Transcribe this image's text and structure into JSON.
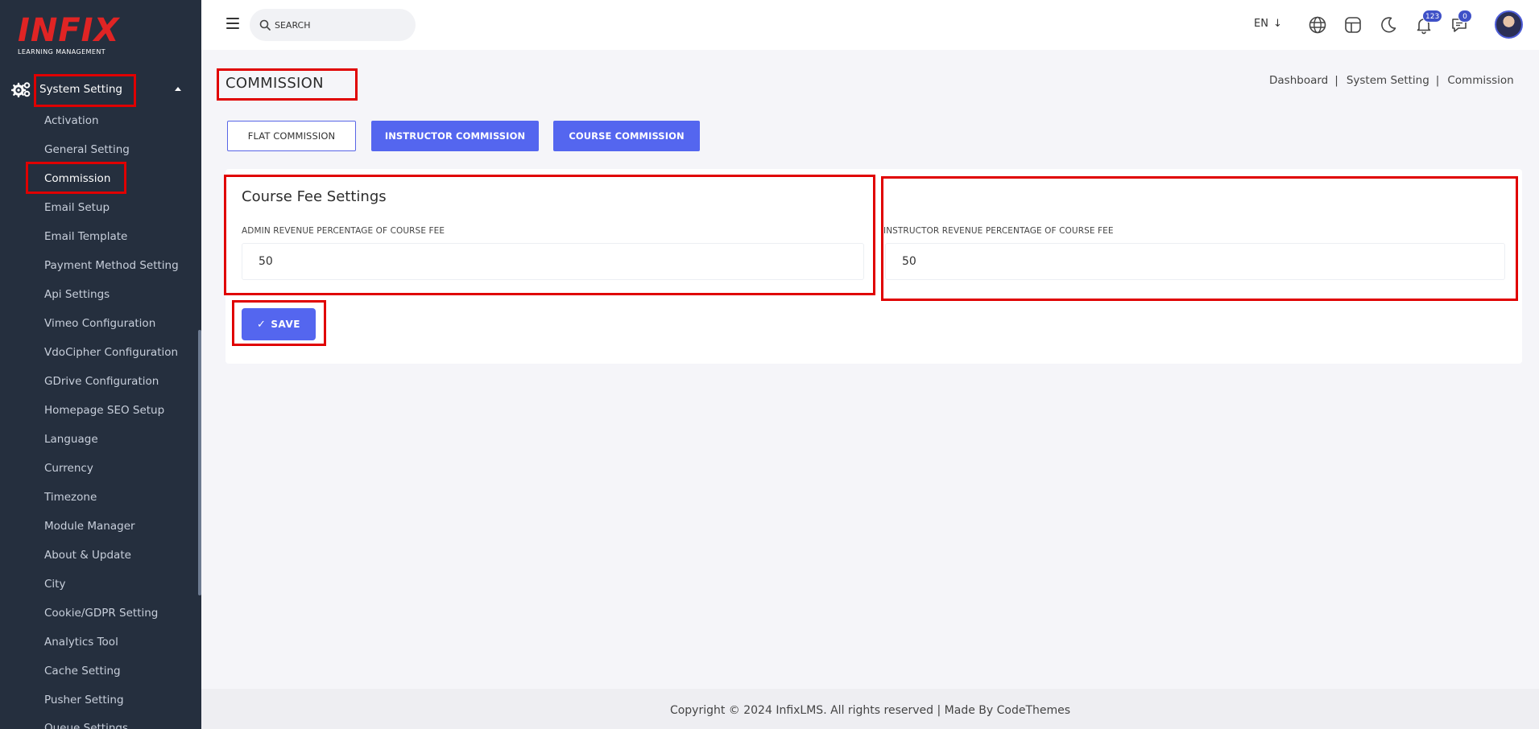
{
  "logo": {
    "brand": "INFIX",
    "tagline": "LEARNING MANAGEMENT"
  },
  "sidebar": {
    "parent": {
      "label": "System Setting",
      "icon": "gears-icon",
      "expanded": true
    },
    "items": [
      {
        "label": "Activation"
      },
      {
        "label": "General Setting"
      },
      {
        "label": "Commission",
        "active": true
      },
      {
        "label": "Email Setup"
      },
      {
        "label": "Email Template"
      },
      {
        "label": "Payment Method Setting"
      },
      {
        "label": "Api Settings"
      },
      {
        "label": "Vimeo Configuration"
      },
      {
        "label": "VdoCipher Configuration"
      },
      {
        "label": "GDrive Configuration"
      },
      {
        "label": "Homepage SEO Setup"
      },
      {
        "label": "Language"
      },
      {
        "label": "Currency"
      },
      {
        "label": "Timezone"
      },
      {
        "label": "Module Manager"
      },
      {
        "label": "About & Update"
      },
      {
        "label": "City"
      },
      {
        "label": "Cookie/GDPR Setting"
      },
      {
        "label": "Analytics Tool"
      },
      {
        "label": "Cache Setting"
      },
      {
        "label": "Pusher Setting"
      },
      {
        "label": "Queue Settings"
      }
    ]
  },
  "topbar": {
    "search_placeholder": "SEARCH",
    "language": "EN",
    "notifications_count": "123",
    "messages_count": "0"
  },
  "page": {
    "title": "COMMISSION",
    "breadcrumb": [
      "Dashboard",
      "System Setting",
      "Commission"
    ]
  },
  "tabs": [
    {
      "label": "FLAT COMMISSION"
    },
    {
      "label": "INSTRUCTOR COMMISSION"
    },
    {
      "label": "COURSE COMMISSION"
    }
  ],
  "form": {
    "title": "Course Fee Settings",
    "admin_label": "ADMIN REVENUE PERCENTAGE OF COURSE FEE",
    "admin_value": "50",
    "instructor_label": "INSTRUCTOR REVENUE PERCENTAGE OF COURSE FEE",
    "instructor_value": "50",
    "save_label": "SAVE"
  },
  "footer": {
    "text": "Copyright © 2024 InfixLMS. All rights reserved | Made By CodeThemes"
  },
  "colors": {
    "sidebar_bg": "#252f3e",
    "accent": "#5466ef",
    "brand_red": "#e02424",
    "highlight": "#e00000"
  }
}
